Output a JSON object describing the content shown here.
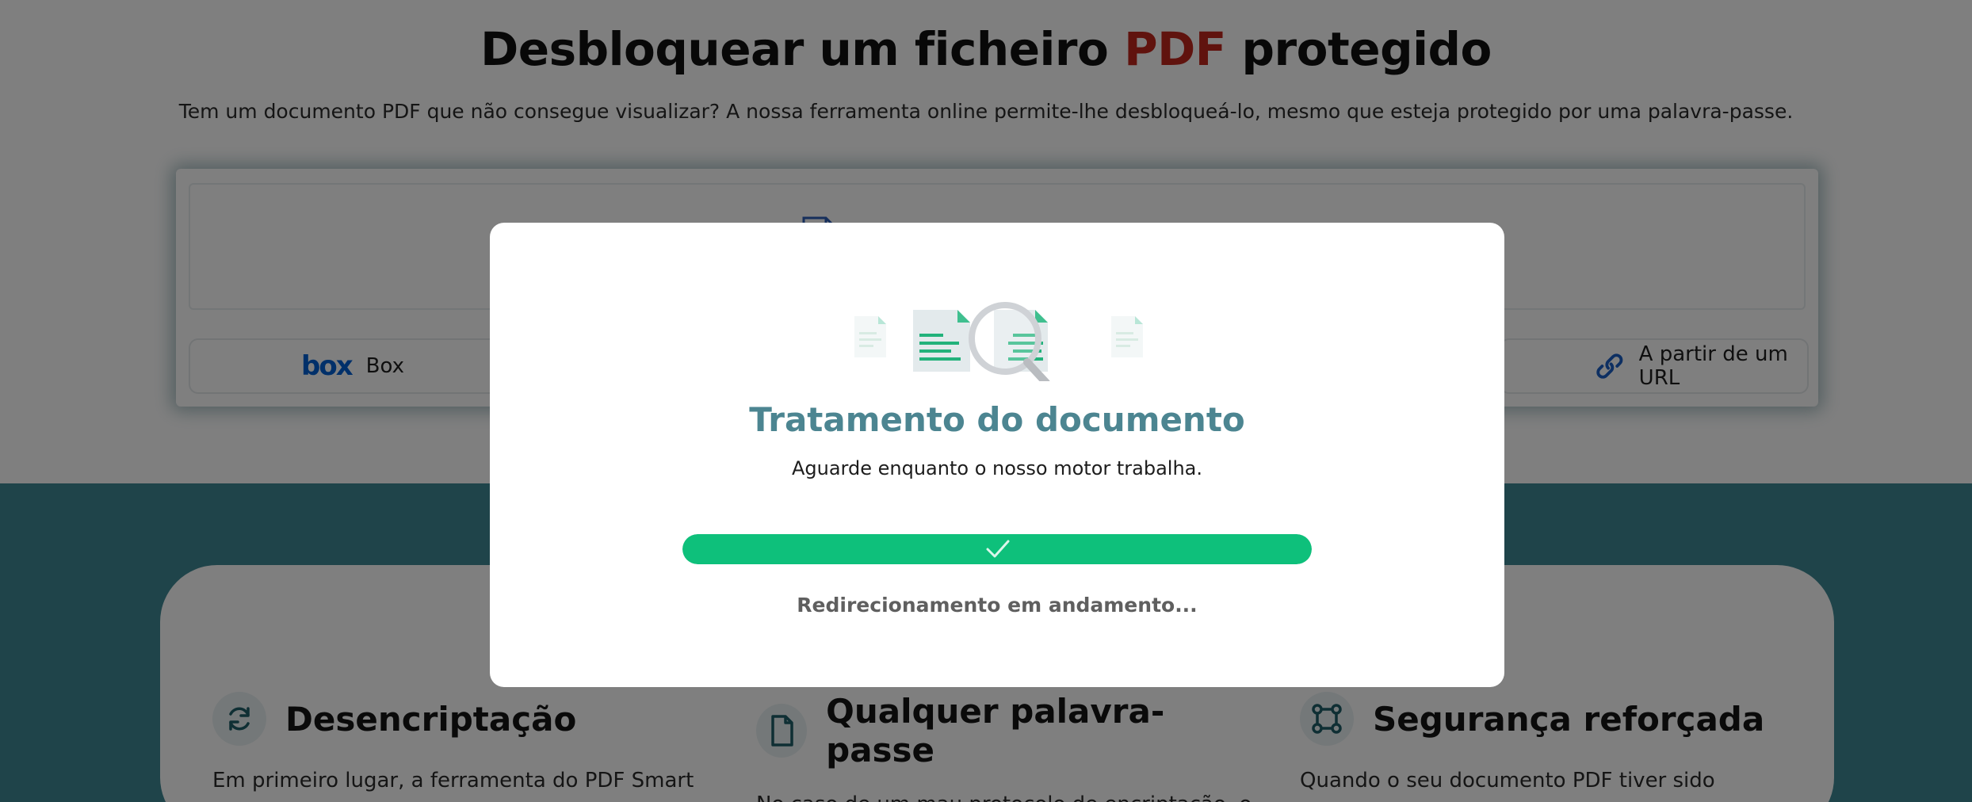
{
  "hero": {
    "title_prefix": "Desbloquear um ficheiro ",
    "title_accent": "PDF",
    "title_suffix": " protegido",
    "subtitle": "Tem um documento PDF que não consegue visualizar? A nossa ferramenta online permite-lhe desbloqueá-lo, mesmo que esteja protegido por uma palavra-passe."
  },
  "upload": {
    "sources": [
      {
        "label": "Box",
        "icon": "box-logo-icon",
        "logo_text": "box"
      },
      {
        "label": "A partir de um URL",
        "icon": "link-icon"
      }
    ]
  },
  "features": [
    {
      "icon": "refresh-icon",
      "title": "Desencriptação",
      "text": "Em primeiro lugar, a ferramenta do PDF Smart"
    },
    {
      "icon": "document-icon",
      "title": "Qualquer palavra-passe",
      "text": "No caso de um mau protocolo de encriptação, o"
    },
    {
      "icon": "network-nodes-icon",
      "title": "Segurança reforçada",
      "text": "Quando o seu documento PDF tiver sido"
    }
  ],
  "modal": {
    "title": "Tratamento do documento",
    "subtitle": "Aguarde enquanto o nosso motor trabalha.",
    "progress_percent": 100,
    "status": "Redirecionamento em andamento..."
  },
  "colors": {
    "accent_red": "#c0271d",
    "teal_band": "#3e8995",
    "modal_title": "#4c8591",
    "progress_green": "#0ec07b",
    "link_blue": "#0061d5"
  }
}
